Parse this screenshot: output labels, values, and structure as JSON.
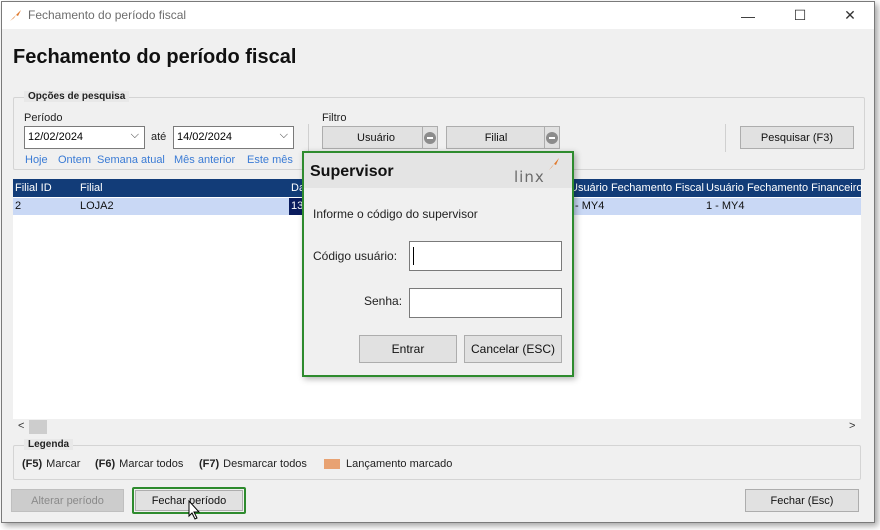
{
  "window": {
    "title": "Fechamento do período fiscal",
    "icons": {
      "app": "linx-arrow-icon",
      "minimize": "minimize-icon",
      "maximize": "maximize-icon",
      "close": "close-icon"
    },
    "glyphs": {
      "minimize": "—",
      "maximize": "☐",
      "close": "✕"
    }
  },
  "page": {
    "title": "Fechamento do período fiscal"
  },
  "search": {
    "group_label": "Opções de pesquisa",
    "period_label": "Período",
    "date_from": "12/02/2024",
    "until_label": "até",
    "date_to": "14/02/2024",
    "filter_label": "Filtro",
    "user_filter_label": "Usuário",
    "branch_filter_label": "Filial",
    "search_button": "Pesquisar (F3)",
    "quick_links": [
      "Hoje",
      "Ontem",
      "Semana atual",
      "Mês anterior",
      "Este mês"
    ],
    "chevron": "⌵"
  },
  "grid": {
    "columns": [
      "Filial ID",
      "Filial",
      "Da",
      "Usuário Fechamento Fiscal",
      "Usuário Fechamento Financeiro"
    ],
    "rows": [
      {
        "filial_id": "2",
        "filial": "LOJA2",
        "date_fragment": "13",
        "fiscal_user": "- MY4",
        "financial_user": "1 - MY4"
      }
    ],
    "scroll_left": "<",
    "scroll_right": ">"
  },
  "legend": {
    "group_label": "Legenda",
    "items": [
      {
        "key": "(F5)",
        "label": "Marcar"
      },
      {
        "key": "(F6)",
        "label": "Marcar todos"
      },
      {
        "key": "(F7)",
        "label": "Desmarcar todos"
      }
    ],
    "marked_label": "Lançamento marcado",
    "marked_color": "#e8a272"
  },
  "footer": {
    "alter_button": "Alterar período",
    "close_period_button": "Fechar período",
    "close_button": "Fechar (Esc)"
  },
  "dialog": {
    "title": "Supervisor",
    "logo_text": "linx",
    "message": "Informe o código do supervisor",
    "user_code_label": "Código usuário:",
    "user_code_value": "",
    "password_label": "Senha:",
    "password_value": "",
    "enter_button": "Entrar",
    "cancel_button": "Cancelar (ESC)"
  },
  "colors": {
    "accent_highlight": "#2e8b2e",
    "grid_header": "#123c78",
    "selected_row": "#c9d8f5",
    "link": "#3a7bd5",
    "logo_accent": "#e07a2e"
  }
}
